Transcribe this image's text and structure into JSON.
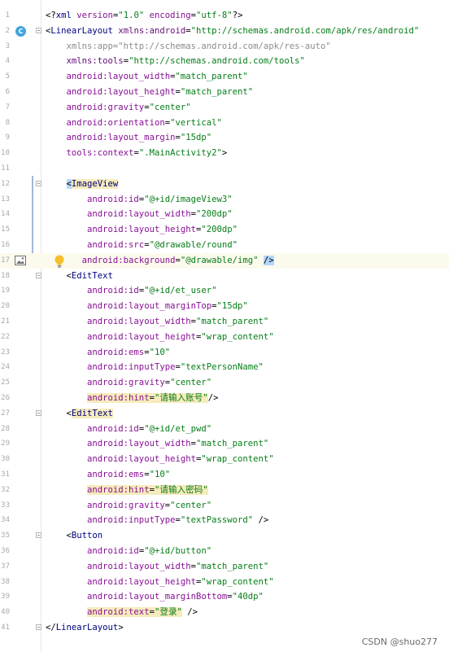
{
  "editor": {
    "lines": [
      {
        "n": "1",
        "segments": [
          {
            "t": "<?",
            "c": "decl"
          },
          {
            "t": "xml ",
            "c": "tag"
          },
          {
            "t": "version",
            "c": "attr"
          },
          {
            "t": "=",
            "c": "decl"
          },
          {
            "t": "\"1.0\"",
            "c": "val"
          },
          {
            "t": " ",
            "c": "decl"
          },
          {
            "t": "encoding",
            "c": "attr"
          },
          {
            "t": "=",
            "c": "decl"
          },
          {
            "t": "\"utf-8\"",
            "c": "val"
          },
          {
            "t": "?>",
            "c": "decl"
          }
        ]
      },
      {
        "n": "2",
        "segments": [
          {
            "t": "<",
            "c": "decl"
          },
          {
            "t": "LinearLayout ",
            "c": "tag"
          },
          {
            "t": "xmlns:android",
            "c": "ns"
          },
          {
            "t": "=",
            "c": "decl"
          },
          {
            "t": "\"http://schemas.android.com/apk/res/android\"",
            "c": "val"
          }
        ]
      },
      {
        "n": "3",
        "segments": [
          {
            "t": "    xmlns:app=\"http://schemas.android.com/apk/res-auto\"",
            "c": "dim"
          }
        ]
      },
      {
        "n": "4",
        "segments": [
          {
            "t": "    ",
            "c": "decl"
          },
          {
            "t": "xmlns:tools",
            "c": "ns"
          },
          {
            "t": "=",
            "c": "decl"
          },
          {
            "t": "\"http://schemas.android.com/tools\"",
            "c": "val"
          }
        ]
      },
      {
        "n": "5",
        "segments": [
          {
            "t": "    ",
            "c": "decl"
          },
          {
            "t": "android:layout_width",
            "c": "attr"
          },
          {
            "t": "=",
            "c": "decl"
          },
          {
            "t": "\"match_parent\"",
            "c": "val"
          }
        ]
      },
      {
        "n": "6",
        "segments": [
          {
            "t": "    ",
            "c": "decl"
          },
          {
            "t": "android:layout_height",
            "c": "attr"
          },
          {
            "t": "=",
            "c": "decl"
          },
          {
            "t": "\"match_parent\"",
            "c": "val"
          }
        ]
      },
      {
        "n": "7",
        "segments": [
          {
            "t": "    ",
            "c": "decl"
          },
          {
            "t": "android:gravity",
            "c": "attr"
          },
          {
            "t": "=",
            "c": "decl"
          },
          {
            "t": "\"center\"",
            "c": "val"
          }
        ]
      },
      {
        "n": "8",
        "segments": [
          {
            "t": "    ",
            "c": "decl"
          },
          {
            "t": "android:orientation",
            "c": "attr"
          },
          {
            "t": "=",
            "c": "decl"
          },
          {
            "t": "\"vertical\"",
            "c": "val"
          }
        ]
      },
      {
        "n": "9",
        "segments": [
          {
            "t": "    ",
            "c": "decl"
          },
          {
            "t": "android:layout_margin",
            "c": "attr"
          },
          {
            "t": "=",
            "c": "decl"
          },
          {
            "t": "\"15dp\"",
            "c": "val"
          }
        ]
      },
      {
        "n": "10",
        "segments": [
          {
            "t": "    ",
            "c": "decl"
          },
          {
            "t": "tools:context",
            "c": "attr"
          },
          {
            "t": "=",
            "c": "decl"
          },
          {
            "t": "\".MainActivity2\"",
            "c": "val"
          },
          {
            "t": ">",
            "c": "decl"
          }
        ]
      },
      {
        "n": "11",
        "segments": []
      },
      {
        "n": "12",
        "segments": [
          {
            "t": "    ",
            "c": "decl"
          },
          {
            "t": "<",
            "c": "hl-tag"
          },
          {
            "t": "ImageView",
            "c": "tag hl-warn"
          }
        ]
      },
      {
        "n": "13",
        "segments": [
          {
            "t": "        ",
            "c": "decl"
          },
          {
            "t": "android:id",
            "c": "attr"
          },
          {
            "t": "=",
            "c": "decl"
          },
          {
            "t": "\"@+id/imageView3\"",
            "c": "val"
          }
        ]
      },
      {
        "n": "14",
        "segments": [
          {
            "t": "        ",
            "c": "decl"
          },
          {
            "t": "android:layout_width",
            "c": "attr"
          },
          {
            "t": "=",
            "c": "decl"
          },
          {
            "t": "\"200dp\"",
            "c": "val"
          }
        ]
      },
      {
        "n": "15",
        "segments": [
          {
            "t": "        ",
            "c": "decl"
          },
          {
            "t": "android:layout_height",
            "c": "attr"
          },
          {
            "t": "=",
            "c": "decl"
          },
          {
            "t": "\"200dp\"",
            "c": "val"
          }
        ]
      },
      {
        "n": "16",
        "segments": [
          {
            "t": "        ",
            "c": "decl"
          },
          {
            "t": "android:src",
            "c": "attr"
          },
          {
            "t": "=",
            "c": "decl"
          },
          {
            "t": "\"@drawable/round\"",
            "c": "val"
          }
        ]
      },
      {
        "n": "17",
        "segments": [
          {
            "t": "       ",
            "c": "decl"
          },
          {
            "t": "android:background",
            "c": "attr"
          },
          {
            "t": "=",
            "c": "decl"
          },
          {
            "t": "\"@drawable/img\"",
            "c": "val"
          },
          {
            "t": " ",
            "c": "decl"
          },
          {
            "t": "/>",
            "c": "hl-tag"
          }
        ]
      },
      {
        "n": "18",
        "segments": [
          {
            "t": "    <",
            "c": "decl"
          },
          {
            "t": "EditText",
            "c": "tag"
          }
        ]
      },
      {
        "n": "19",
        "segments": [
          {
            "t": "        ",
            "c": "decl"
          },
          {
            "t": "android:id",
            "c": "attr"
          },
          {
            "t": "=",
            "c": "decl"
          },
          {
            "t": "\"@+id/et_user\"",
            "c": "val"
          }
        ]
      },
      {
        "n": "20",
        "segments": [
          {
            "t": "        ",
            "c": "decl"
          },
          {
            "t": "android:layout_marginTop",
            "c": "attr"
          },
          {
            "t": "=",
            "c": "decl"
          },
          {
            "t": "\"15dp\"",
            "c": "val"
          }
        ]
      },
      {
        "n": "21",
        "segments": [
          {
            "t": "        ",
            "c": "decl"
          },
          {
            "t": "android:layout_width",
            "c": "attr"
          },
          {
            "t": "=",
            "c": "decl"
          },
          {
            "t": "\"match_parent\"",
            "c": "val"
          }
        ]
      },
      {
        "n": "22",
        "segments": [
          {
            "t": "        ",
            "c": "decl"
          },
          {
            "t": "android:layout_height",
            "c": "attr"
          },
          {
            "t": "=",
            "c": "decl"
          },
          {
            "t": "\"wrap_content\"",
            "c": "val"
          }
        ]
      },
      {
        "n": "23",
        "segments": [
          {
            "t": "        ",
            "c": "decl"
          },
          {
            "t": "android:ems",
            "c": "attr"
          },
          {
            "t": "=",
            "c": "decl"
          },
          {
            "t": "\"10\"",
            "c": "val"
          }
        ]
      },
      {
        "n": "24",
        "segments": [
          {
            "t": "        ",
            "c": "decl"
          },
          {
            "t": "android:inputType",
            "c": "attr"
          },
          {
            "t": "=",
            "c": "decl"
          },
          {
            "t": "\"textPersonName\"",
            "c": "val"
          }
        ]
      },
      {
        "n": "25",
        "segments": [
          {
            "t": "        ",
            "c": "decl"
          },
          {
            "t": "android:gravity",
            "c": "attr"
          },
          {
            "t": "=",
            "c": "decl"
          },
          {
            "t": "\"center\"",
            "c": "val"
          }
        ]
      },
      {
        "n": "26",
        "segments": [
          {
            "t": "        ",
            "c": "decl"
          },
          {
            "t": "android:hint",
            "c": "attr hl-warn"
          },
          {
            "t": "=",
            "c": "decl hl-warn"
          },
          {
            "t": "\"请输入账号\"",
            "c": "val hl-warn"
          },
          {
            "t": "/>",
            "c": "decl"
          }
        ]
      },
      {
        "n": "27",
        "segments": [
          {
            "t": "    <",
            "c": "decl"
          },
          {
            "t": "EditText",
            "c": "tag hl-warn"
          }
        ]
      },
      {
        "n": "28",
        "segments": [
          {
            "t": "        ",
            "c": "decl"
          },
          {
            "t": "android:id",
            "c": "attr"
          },
          {
            "t": "=",
            "c": "decl"
          },
          {
            "t": "\"@+id/et_pwd\"",
            "c": "val"
          }
        ]
      },
      {
        "n": "29",
        "segments": [
          {
            "t": "        ",
            "c": "decl"
          },
          {
            "t": "android:layout_width",
            "c": "attr"
          },
          {
            "t": "=",
            "c": "decl"
          },
          {
            "t": "\"match_parent\"",
            "c": "val"
          }
        ]
      },
      {
        "n": "30",
        "segments": [
          {
            "t": "        ",
            "c": "decl"
          },
          {
            "t": "android:layout_height",
            "c": "attr"
          },
          {
            "t": "=",
            "c": "decl"
          },
          {
            "t": "\"wrap_content\"",
            "c": "val"
          }
        ]
      },
      {
        "n": "31",
        "segments": [
          {
            "t": "        ",
            "c": "decl"
          },
          {
            "t": "android:ems",
            "c": "attr"
          },
          {
            "t": "=",
            "c": "decl"
          },
          {
            "t": "\"10\"",
            "c": "val"
          }
        ]
      },
      {
        "n": "32",
        "segments": [
          {
            "t": "        ",
            "c": "decl"
          },
          {
            "t": "android:hint",
            "c": "attr hl-warn"
          },
          {
            "t": "=",
            "c": "decl hl-warn"
          },
          {
            "t": "\"请输入密码\"",
            "c": "val hl-warn"
          }
        ]
      },
      {
        "n": "33",
        "segments": [
          {
            "t": "        ",
            "c": "decl"
          },
          {
            "t": "android:gravity",
            "c": "attr"
          },
          {
            "t": "=",
            "c": "decl"
          },
          {
            "t": "\"center\"",
            "c": "val"
          }
        ]
      },
      {
        "n": "34",
        "segments": [
          {
            "t": "        ",
            "c": "decl"
          },
          {
            "t": "android:inputType",
            "c": "attr"
          },
          {
            "t": "=",
            "c": "decl"
          },
          {
            "t": "\"textPassword\"",
            "c": "val"
          },
          {
            "t": " />",
            "c": "decl"
          }
        ]
      },
      {
        "n": "35",
        "segments": [
          {
            "t": "    <",
            "c": "decl"
          },
          {
            "t": "Button",
            "c": "tag"
          }
        ]
      },
      {
        "n": "36",
        "segments": [
          {
            "t": "        ",
            "c": "decl"
          },
          {
            "t": "android:id",
            "c": "attr"
          },
          {
            "t": "=",
            "c": "decl"
          },
          {
            "t": "\"@+id/button\"",
            "c": "val"
          }
        ]
      },
      {
        "n": "37",
        "segments": [
          {
            "t": "        ",
            "c": "decl"
          },
          {
            "t": "android:layout_width",
            "c": "attr"
          },
          {
            "t": "=",
            "c": "decl"
          },
          {
            "t": "\"match_parent\"",
            "c": "val"
          }
        ]
      },
      {
        "n": "38",
        "segments": [
          {
            "t": "        ",
            "c": "decl"
          },
          {
            "t": "android:layout_height",
            "c": "attr"
          },
          {
            "t": "=",
            "c": "decl"
          },
          {
            "t": "\"wrap_content\"",
            "c": "val"
          }
        ]
      },
      {
        "n": "39",
        "segments": [
          {
            "t": "        ",
            "c": "decl"
          },
          {
            "t": "android:layout_marginBottom",
            "c": "attr"
          },
          {
            "t": "=",
            "c": "decl"
          },
          {
            "t": "\"40dp\"",
            "c": "val"
          }
        ]
      },
      {
        "n": "40",
        "segments": [
          {
            "t": "        ",
            "c": "decl"
          },
          {
            "t": "android:text",
            "c": "attr hl-warn"
          },
          {
            "t": "=",
            "c": "decl hl-warn"
          },
          {
            "t": "\"登录\"",
            "c": "val hl-warn"
          },
          {
            "t": " />",
            "c": "decl"
          }
        ]
      },
      {
        "n": "41",
        "segments": [
          {
            "t": "</",
            "c": "decl"
          },
          {
            "t": "LinearLayout",
            "c": "tag"
          },
          {
            "t": ">",
            "c": "decl"
          }
        ]
      }
    ],
    "fold_lines": [
      "2",
      "12",
      "18",
      "27",
      "35",
      "41"
    ],
    "caret_line": "17",
    "badge_letter": "C",
    "gutter_icons": {
      "class_badge_line": "2",
      "image_line": "17",
      "bulb_line": "17"
    }
  },
  "watermark": "CSDN @shuo277",
  "colors": {
    "tag": "#000080",
    "attribute": "#871094",
    "value": "#067d17",
    "background": "#ffffff"
  }
}
